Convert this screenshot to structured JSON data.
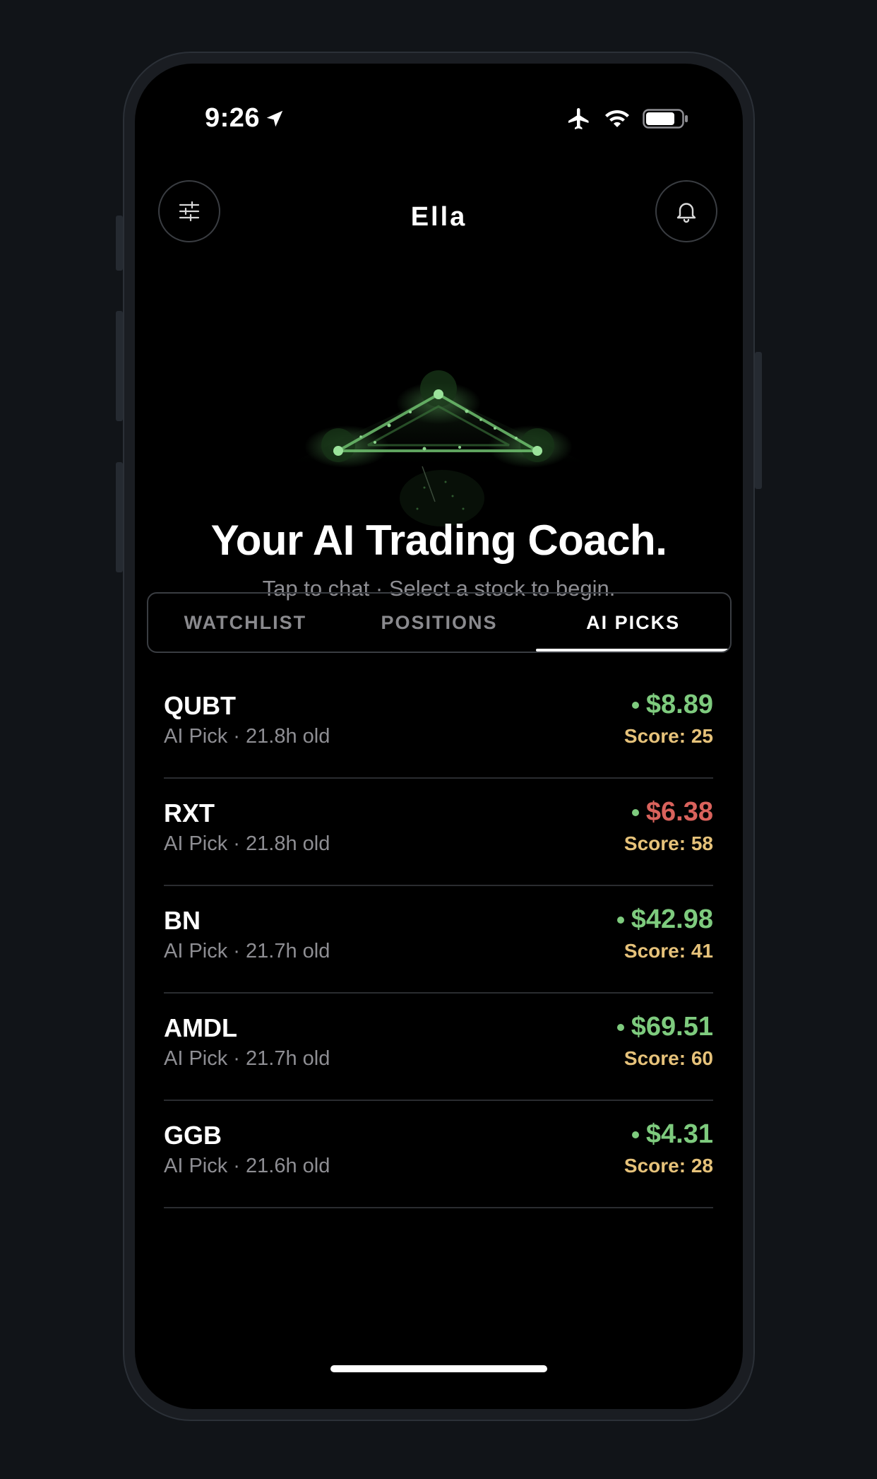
{
  "status_bar": {
    "time": "9:26",
    "icons": [
      "location-arrow-icon",
      "airplane-icon",
      "wifi-icon",
      "battery-icon"
    ]
  },
  "header": {
    "title": "Ella",
    "left_icon": "sliders-icon",
    "right_icon": "bell-icon"
  },
  "hero": {
    "title": "Your AI Trading Coach.",
    "subtitle": "Tap to chat · Select a stock to begin."
  },
  "tabs": [
    {
      "label": "WATCHLIST",
      "active": false
    },
    {
      "label": "POSITIONS",
      "active": false
    },
    {
      "label": "AI PICKS",
      "active": true
    }
  ],
  "picks": [
    {
      "ticker": "QUBT",
      "meta": "AI Pick · 21.8h old",
      "price": "$8.89",
      "score": "Score: 25",
      "price_color": "#7ecb7e",
      "dot_color": "#7ecb7e"
    },
    {
      "ticker": "RXT",
      "meta": "AI Pick · 21.8h old",
      "price": "$6.38",
      "score": "Score: 58",
      "price_color": "#d9625c",
      "dot_color": "#7ecb7e"
    },
    {
      "ticker": "BN",
      "meta": "AI Pick · 21.7h old",
      "price": "$42.98",
      "score": "Score: 41",
      "price_color": "#7ecb7e",
      "dot_color": "#7ecb7e"
    },
    {
      "ticker": "AMDL",
      "meta": "AI Pick · 21.7h old",
      "price": "$69.51",
      "score": "Score: 60",
      "price_color": "#7ecb7e",
      "dot_color": "#7ecb7e"
    },
    {
      "ticker": "GGB",
      "meta": "AI Pick · 21.6h old",
      "price": "$4.31",
      "score": "Score: 28",
      "price_color": "#7ecb7e",
      "dot_color": "#7ecb7e"
    }
  ],
  "colors": {
    "score": "#e6c27a",
    "accent_green": "#7ecb7e",
    "negative_red": "#d9625c"
  }
}
